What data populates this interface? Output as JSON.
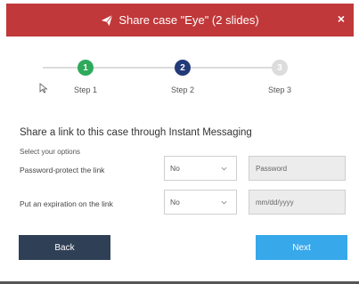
{
  "header": {
    "title": "Share case \"Eye\" (2 slides)",
    "close_glyph": "×",
    "color": "#c0383a"
  },
  "stepper": {
    "steps": [
      {
        "number": "1",
        "label": "Step 1",
        "state": "done",
        "color": "#2eaa5c"
      },
      {
        "number": "2",
        "label": "Step 2",
        "state": "current",
        "color": "#233a7a"
      },
      {
        "number": "3",
        "label": "Step 3",
        "state": "todo",
        "color": "#dcdcdc"
      }
    ]
  },
  "main": {
    "section_title": "Share a link to this case through Instant Messaging",
    "subhead": "Select your options",
    "rows": [
      {
        "label": "Password-protect the link",
        "select_value": "No",
        "input_placeholder": "Password"
      },
      {
        "label": "Put an expiration on the link",
        "select_value": "No",
        "input_placeholder": "mm/dd/yyyy"
      }
    ]
  },
  "footer": {
    "back_label": "Back",
    "next_label": "Next"
  }
}
